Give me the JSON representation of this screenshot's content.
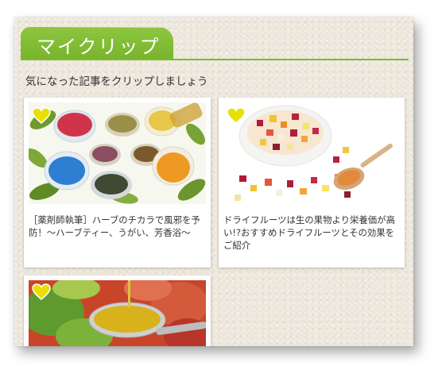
{
  "section": {
    "title": "マイクリップ",
    "intro": "気になった記事をクリップしましょう"
  },
  "colors": {
    "accent_green": "#7cb831",
    "heart_yellow": "#e8e000",
    "panel_bg": "#ede7dc"
  },
  "articles": [
    {
      "title": "［薬剤師執筆］ハーブのチカラで風邪を予防！～ハーブティー、うがい、芳香浴～",
      "image": "herbal-tea-cups",
      "clip_icon": "heart-clip-icon"
    },
    {
      "title": "ドライフルーツは生の果物より栄養価が高い!?おすすめドライフルーツとその効果をご紹介",
      "image": "dried-fruit-bowl",
      "clip_icon": "heart-clip-icon"
    },
    {
      "title": "",
      "image": "olive-oil-spoon-salad",
      "clip_icon": "heart-clip-icon"
    }
  ]
}
